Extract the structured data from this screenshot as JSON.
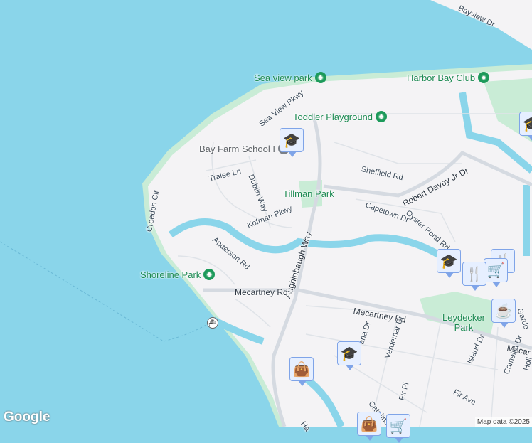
{
  "parks": {
    "sea_view": "Sea view park",
    "harbor_bay": "Harbor Bay Club",
    "toddler": "Toddler Playground",
    "tillman": "Tillman Park",
    "shoreline": "Shoreline Park",
    "leydecker": "Leydecker Park",
    "school": "Bay Farm School I"
  },
  "streets": [
    "Bayview Dr",
    "Sea View Pkwy",
    "Sheffield Rd",
    "Robert Davey Jr Dr",
    "Tralee Ln",
    "Dublin Way",
    "Capetown Dr",
    "Oyster Pond Rd",
    "Kofman Pkwy",
    "Creedon Cir",
    "Anderson Rd",
    "Aughinbaugh Way",
    "Mecartney Rd",
    "Mecartney Rd",
    "Mecar",
    "Verdemar Dr",
    "ana Dr",
    "Island Dr",
    "Camellia Dr",
    "Fir Pl",
    "Fir Ave",
    "Catalina",
    "Garde",
    "Holl",
    "Ha"
  ],
  "icons": {
    "school": "school-icon",
    "restaurant": "restaurant-icon",
    "cart": "shopping-cart-icon",
    "bag": "shopping-bag-icon",
    "coffee": "coffee-icon",
    "park": "tree-icon",
    "ferry": "ferry-icon"
  },
  "footer": {
    "logo": "Google",
    "attribution": "Map data ©2025"
  },
  "colors": {
    "water": "#8ad5ea",
    "land": "#f4f3f5",
    "park": "#c9ecd6"
  }
}
